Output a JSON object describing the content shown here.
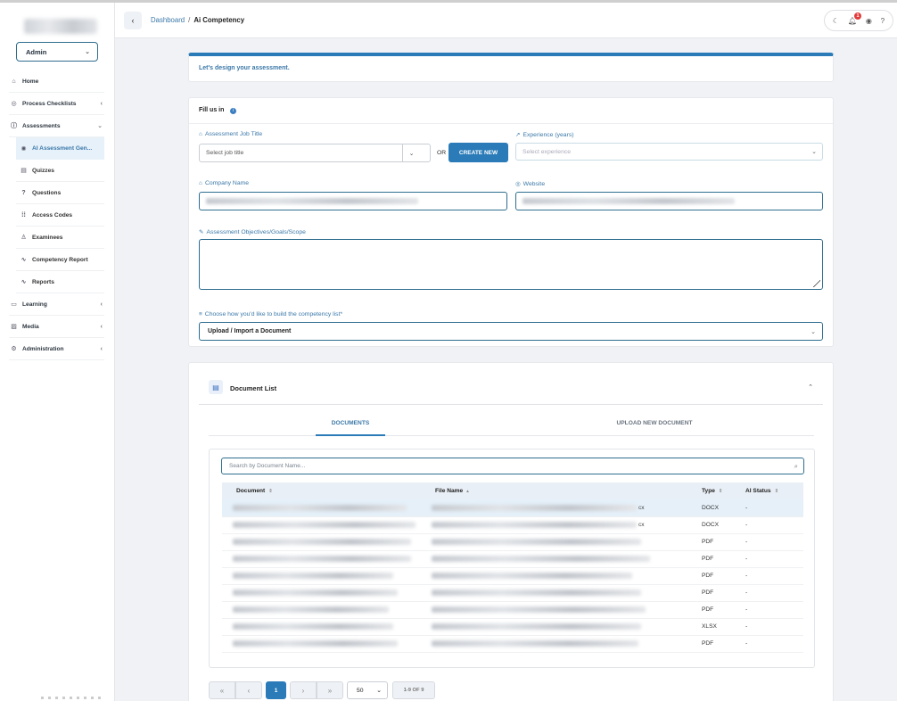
{
  "sidebar": {
    "role": "Admin",
    "items": [
      {
        "label": "Home",
        "icon": "home-icon"
      },
      {
        "label": "Process Checklists",
        "icon": "check-circle-icon"
      },
      {
        "label": "Assessments",
        "icon": "help-circle-icon"
      },
      {
        "label": "AI Assessment Gen...",
        "icon": "bulb-icon"
      },
      {
        "label": "Quizzes",
        "icon": "document-icon"
      },
      {
        "label": "Questions",
        "icon": "question-mark-icon"
      },
      {
        "label": "Access Codes",
        "icon": "grid-icon"
      },
      {
        "label": "Examinees",
        "icon": "user-icon"
      },
      {
        "label": "Competency Report",
        "icon": "pulse-icon"
      },
      {
        "label": "Reports",
        "icon": "pulse-icon"
      },
      {
        "label": "Learning",
        "icon": "book-icon"
      },
      {
        "label": "Media",
        "icon": "image-icon"
      },
      {
        "label": "Administration",
        "icon": "gear-icon"
      }
    ]
  },
  "header": {
    "breadcrumb_link": "Dashboard",
    "breadcrumb_sep": "/",
    "breadcrumb_current": "Ai Competency",
    "notification_count": "1"
  },
  "banner": {
    "text": "Let's design your assessment."
  },
  "form": {
    "title": "Fill us in",
    "job_title_label": "Assessment Job Title",
    "job_title_placeholder": "Select job title",
    "or_text": "OR",
    "create_new_label": "CREATE NEW",
    "experience_label": "Experience (years)",
    "experience_placeholder": "Select experience",
    "company_label": "Company Name",
    "website_label": "Website",
    "objectives_label": "Assessment Objectives/Goals/Scope",
    "build_label": "Choose how you'd like to build the competency list*",
    "build_value": "Upload / Import a Document"
  },
  "documents": {
    "title": "Document List",
    "tab_documents": "DOCUMENTS",
    "tab_upload": "UPLOAD NEW DOCUMENT",
    "search_placeholder": "Search by Document Name...",
    "columns": [
      "Document",
      "File Name",
      "Type",
      "AI Status"
    ],
    "rows": [
      {
        "type": "DOCX",
        "status": "-",
        "ext": "cx"
      },
      {
        "type": "DOCX",
        "status": "-",
        "ext": "cx"
      },
      {
        "type": "PDF",
        "status": "-",
        "ext": ""
      },
      {
        "type": "PDF",
        "status": "-",
        "ext": ""
      },
      {
        "type": "PDF",
        "status": "-",
        "ext": ""
      },
      {
        "type": "PDF",
        "status": "-",
        "ext": ""
      },
      {
        "type": "PDF",
        "status": "-",
        "ext": ""
      },
      {
        "type": "XLSX",
        "status": "-",
        "ext": ""
      },
      {
        "type": "PDF",
        "status": "-",
        "ext": ""
      }
    ]
  },
  "pagination": {
    "first": "«",
    "prev": "‹",
    "current": "1",
    "next": "›",
    "last": "»",
    "page_size": "50",
    "count": "1-9 OF 9"
  },
  "colors": {
    "accent": "#2a7bb8",
    "teal_border": "#2f6e8e",
    "selected_row": "#e5f0f9",
    "badge": "#e23b3b"
  }
}
